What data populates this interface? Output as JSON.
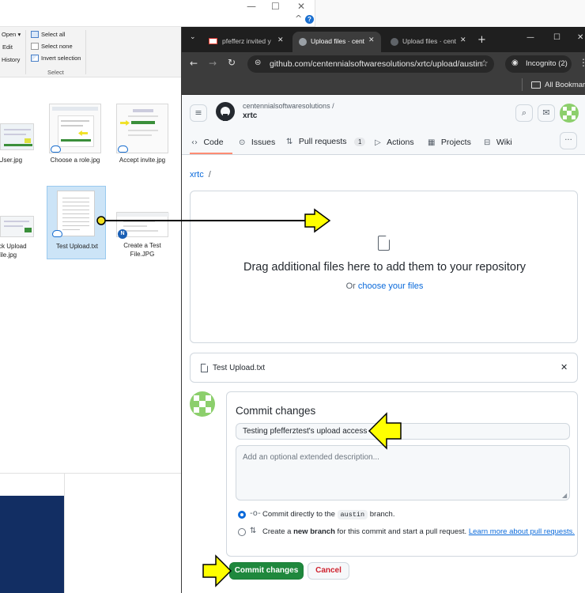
{
  "colors": {
    "github_green": "#1f883d",
    "link_blue": "#0969da",
    "annotation_yellow": "#ffff00",
    "explorer_navy": "#122e63"
  },
  "explorer": {
    "window_controls": {
      "minimize": "—",
      "maximize": "☐",
      "close": "✕",
      "chevron": "^",
      "help": "?"
    },
    "ribbon": {
      "items_left": [
        "Open",
        "Edit",
        "History"
      ],
      "items_right": [
        "Select all",
        "Select none",
        "Invert selection"
      ],
      "group_label": "Select"
    },
    "files": [
      {
        "name": "d User.jpg"
      },
      {
        "name": "Choose a role.jpg"
      },
      {
        "name": "Accept invite.jpg"
      },
      {
        "name": "ck Upload file.jpg"
      },
      {
        "name": "Test Upload.txt"
      },
      {
        "name": "Create a Test File.JPG"
      }
    ]
  },
  "browser": {
    "tabs": [
      {
        "label": "pfefferz invited y",
        "icon": "gmail-icon"
      },
      {
        "label": "Upload files · cent",
        "icon": "github-icon"
      },
      {
        "label": "Upload files · cent",
        "icon": "github-icon"
      }
    ],
    "new_tab": "+",
    "url": "github.com/centennialsoftwaresolutions/xrtc/upload/austin",
    "incognito_label": "Incognito (2)",
    "bookmarks_label": "All Bookmarks"
  },
  "github": {
    "owner": "centennialsoftwaresolutions /",
    "repo": "xrtc",
    "nav": [
      {
        "label": "Code",
        "icon": "code-icon"
      },
      {
        "label": "Issues",
        "icon": "issue-icon"
      },
      {
        "label": "Pull requests",
        "icon": "pr-icon",
        "count": "1"
      },
      {
        "label": "Actions",
        "icon": "play-icon"
      },
      {
        "label": "Projects",
        "icon": "table-icon"
      },
      {
        "label": "Wiki",
        "icon": "book-icon"
      }
    ],
    "breadcrumb": {
      "repo": "xrtc",
      "sep": "/"
    },
    "dropzone": {
      "heading": "Drag additional files here to add them to your repository",
      "sub_prefix": "Or",
      "sub_link": "choose your files"
    },
    "file": {
      "name": "Test Upload.txt"
    },
    "commit": {
      "title": "Commit changes",
      "message_value": "Testing pfefferztest's upload access",
      "description_placeholder": "Add an optional extended description...",
      "option1": {
        "prefix": "Commit directly to the",
        "branch": "austin",
        "suffix": "branch.",
        "selected": true
      },
      "option2": {
        "prefix": "Create a",
        "bold": "new branch",
        "suffix": "for this commit and start a pull request.",
        "link": "Learn more about pull requests.",
        "selected": false
      },
      "commit_button": "Commit changes",
      "cancel_button": "Cancel"
    }
  }
}
